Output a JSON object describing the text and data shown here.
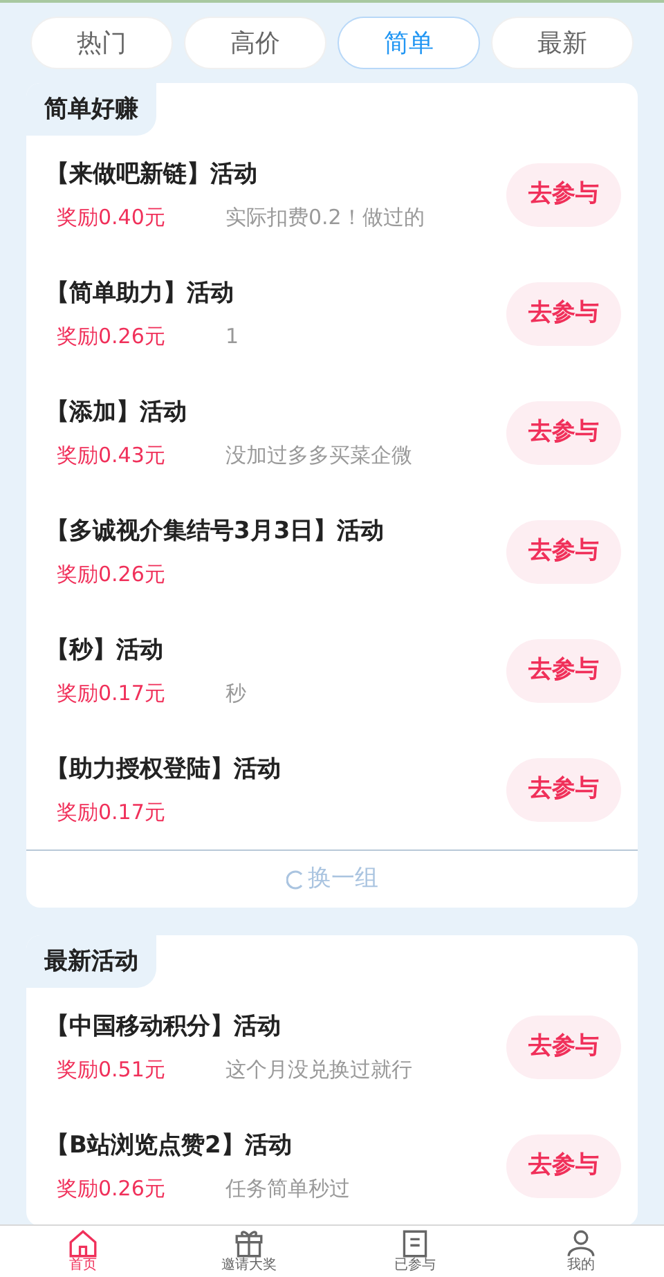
{
  "tabs": [
    {
      "label": "热门",
      "selected": false
    },
    {
      "label": "高价",
      "selected": false
    },
    {
      "label": "简单",
      "selected": true
    },
    {
      "label": "最新",
      "selected": false
    }
  ],
  "sections": [
    {
      "title": "简单好赚",
      "items": [
        {
          "title": "【来做吧新链】活动",
          "reward": "奖励0.40元",
          "note": "实际扣费0.2！做过的",
          "button": "去参与"
        },
        {
          "title": "【简单助力】活动",
          "reward": "奖励0.26元",
          "note": "1",
          "button": "去参与"
        },
        {
          "title": "【添加】活动",
          "reward": "奖励0.43元",
          "note": "没加过多多买菜企微",
          "button": "去参与"
        },
        {
          "title": "【多诚视介集结号3月3日】活动",
          "reward": "奖励0.26元",
          "button": "去参与"
        },
        {
          "title": "【秒】活动",
          "reward": "奖励0.17元",
          "note": "秒",
          "button": "去参与"
        },
        {
          "title": "【助力授权登陆】活动",
          "reward": "奖励0.17元",
          "button": "去参与"
        }
      ],
      "refresh": "换一组"
    },
    {
      "title": "最新活动",
      "items": [
        {
          "title": "【中国移动积分】活动",
          "reward": "奖励0.51元",
          "note": "这个月没兑换过就行",
          "button": "去参与"
        },
        {
          "title": "【B站浏览点赞2】活动",
          "reward": "奖励0.26元",
          "note": "任务简单秒过",
          "button": "去参与"
        }
      ]
    }
  ],
  "bottom_nav": [
    {
      "label": "首页",
      "selected": true,
      "kind": "home"
    },
    {
      "label": "邀请大奖",
      "selected": false,
      "kind": "gift"
    },
    {
      "label": "已参与",
      "selected": false,
      "kind": "doc"
    },
    {
      "label": "我的",
      "selected": false,
      "kind": "user"
    }
  ]
}
